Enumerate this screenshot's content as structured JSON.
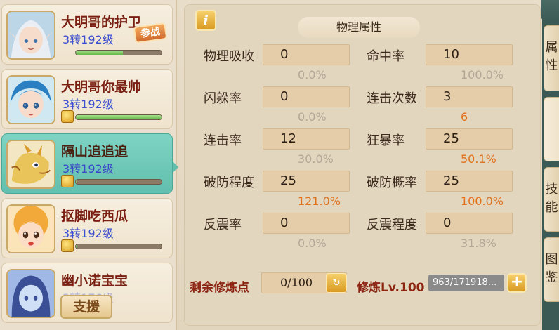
{
  "roster": {
    "heroes": [
      {
        "name": "大明哥的护卫",
        "level": "3转192级",
        "exp": 0.55,
        "badge": "参战"
      },
      {
        "name": "大明哥你最帅",
        "level": "3转192级",
        "exp": 1.0,
        "badge": ""
      },
      {
        "name": "隔山追追追",
        "level": "3转192级",
        "exp": 0.02,
        "badge": ""
      },
      {
        "name": "抠脚吃西瓜",
        "level": "3转192级",
        "exp": 0.02,
        "badge": ""
      },
      {
        "name": "幽小诺宝宝",
        "level": "3转176级",
        "exp": 0.0,
        "badge": ""
      }
    ],
    "support_label": "支援",
    "selected_index": 2
  },
  "panel": {
    "info_label": "i",
    "section_title": "物理属性",
    "stats": [
      {
        "label": "物理吸收",
        "value": "0",
        "sub": "0.0%",
        "highlight": false
      },
      {
        "label": "命中率",
        "value": "10",
        "sub": "100.0%",
        "highlight": false
      },
      {
        "label": "闪躲率",
        "value": "0",
        "sub": "0.0%",
        "highlight": false
      },
      {
        "label": "连击次数",
        "value": "3",
        "sub": "6",
        "highlight": true
      },
      {
        "label": "连击率",
        "value": "12",
        "sub": "30.0%",
        "highlight": false
      },
      {
        "label": "狂暴率",
        "value": "25",
        "sub": "50.1%",
        "highlight": true
      },
      {
        "label": "破防程度",
        "value": "25",
        "sub": "121.0%",
        "highlight": true
      },
      {
        "label": "破防概率",
        "value": "25",
        "sub": "100.0%",
        "highlight": true
      },
      {
        "label": "反震率",
        "value": "0",
        "sub": "0.0%",
        "highlight": false
      },
      {
        "label": "反震程度",
        "value": "0",
        "sub": "31.8%",
        "highlight": false
      }
    ],
    "remaining_points_label": "剩余修炼点",
    "remaining_points_value": "0/100",
    "reset_label": "↻",
    "cultivation_label": "修炼Lv.100",
    "cultivation_exp": "963/171918...",
    "plus_label": "+"
  },
  "side_tabs": [
    {
      "label": "属性"
    },
    {
      "label": ""
    },
    {
      "label": "技能"
    },
    {
      "label": "图鉴"
    }
  ],
  "colors": {
    "name_red": "#7a1f12",
    "level_blue": "#3c4fd0",
    "selected_teal": "#62bfae",
    "orange_value": "#e0721c",
    "grey_value": "#b4a796"
  }
}
